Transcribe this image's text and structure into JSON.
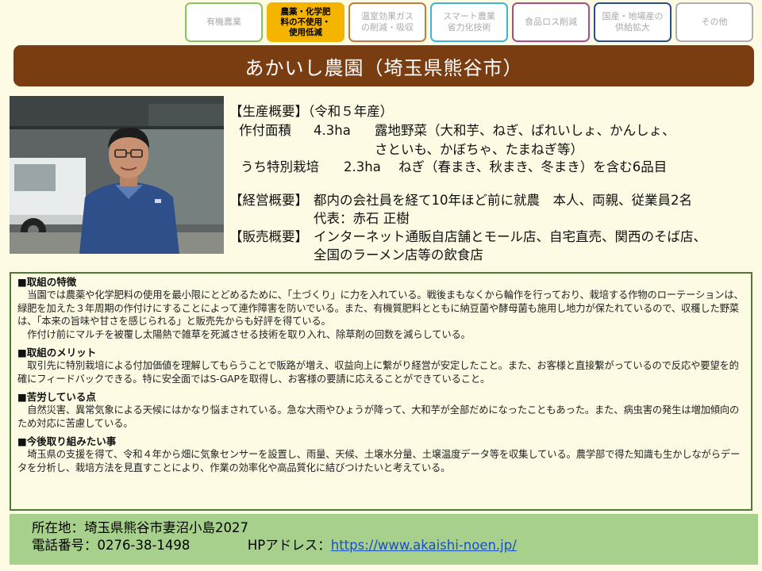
{
  "tabs": [
    {
      "label": "有機農業",
      "color": "#8bc45e",
      "active": false
    },
    {
      "label": "農薬・化学肥\n料の不使用・\n使用低減",
      "color": "#f5b400",
      "active": true
    },
    {
      "label": "温室効果ガス\nの削減・吸収",
      "color": "#c47a3a",
      "active": false
    },
    {
      "label": "スマート農業\n省力化技術",
      "color": "#3fb6d9",
      "active": false
    },
    {
      "label": "食品ロス削減",
      "color": "#a64d8c",
      "active": false
    },
    {
      "label": "国産・地場産の\n供給拡大",
      "color": "#2e4f8a",
      "active": false
    },
    {
      "label": "その他",
      "color": "#b0b0b0",
      "active": false
    }
  ],
  "title": "あかいし農園（埼玉県熊谷市）",
  "overview": {
    "production_head": "【生産概要】（令和５年産）",
    "area_label": "作付面積",
    "area_value": "4.3ha",
    "area_crops_1": "露地野菜（大和芋、ねぎ、ばれいしょ、かんしょ、",
    "area_crops_2": "さといも、かぼちゃ、たまねぎ等）",
    "special_label": "うち特別栽培",
    "special_value": "2.3ha",
    "special_crops": "ねぎ（春まき、秋まき、冬まき）を含む6品目",
    "management_head": "【経営概要】",
    "management_1": "都内の会社員を経て10年ほど前に就農　本人、両親、従業員2名",
    "management_2": "代表：赤石 正樹",
    "sales_head": "【販売概要】",
    "sales_1": "インターネット通販自店舗とモール店、自宅直売、関西のそば店、",
    "sales_2": "全国のラーメン店等の飲食店"
  },
  "sections": [
    {
      "heading": "■取組の特徴",
      "paragraphs": [
        "当園では農薬や化学肥料の使用を最小限にとどめるために、「土づくり」に力を入れている。戦後まもなくから輪作を行っており、栽培する作物のローテーションは、緑肥を加えた３年周期の作付けにすることによって連作障害を防いでいる。また、有機質肥料とともに納豆菌や酵母菌も施用し地力が保たれているので、収穫した野菜は、「本来の旨味や甘さを感じられる」と販売先からも好評を得ている。",
        "作付け前にマルチを被覆し太陽熱で雑草を死滅させる技術を取り入れ、除草剤の回数を減らしている。"
      ]
    },
    {
      "heading": "■取組のメリット",
      "paragraphs": [
        "取引先に特別栽培による付加価値を理解してもらうことで販路が増え、収益向上に繋がり経営が安定したこと。また、お客様と直接繋がっているので反応や要望を的確にフィードバックできる。特に安全面ではS-GAPを取得し、お客様の要請に応えることができていること。"
      ]
    },
    {
      "heading": "■苦労している点",
      "paragraphs": [
        "自然災害、異常気象による天候にはかなり悩まされている。急な大雨やひょうが降って、大和芋が全部だめになったこともあった。また、病虫害の発生は増加傾向のため対応に苦慮している。"
      ]
    },
    {
      "heading": "■今後取り組みたい事",
      "paragraphs": [
        "埼玉県の支援を得て、令和４年から畑に気象センサーを設置し、雨量、天候、土壌水分量、土壌温度データ等を収集している。農学部で得た知識も生かしながらデータを分析し、栽培方法を見直すことにより、作業の効率化や高品質化に結びつけたいと考えている。"
      ]
    }
  ],
  "footer": {
    "address_label": "所在地：",
    "address": "埼玉県熊谷市妻沼小島2027",
    "phone_label": "電話番号：",
    "phone": "0276-38-1498",
    "hp_label": "HPアドレス：",
    "hp_url": "https://www.akaishi-noen.jp/"
  }
}
